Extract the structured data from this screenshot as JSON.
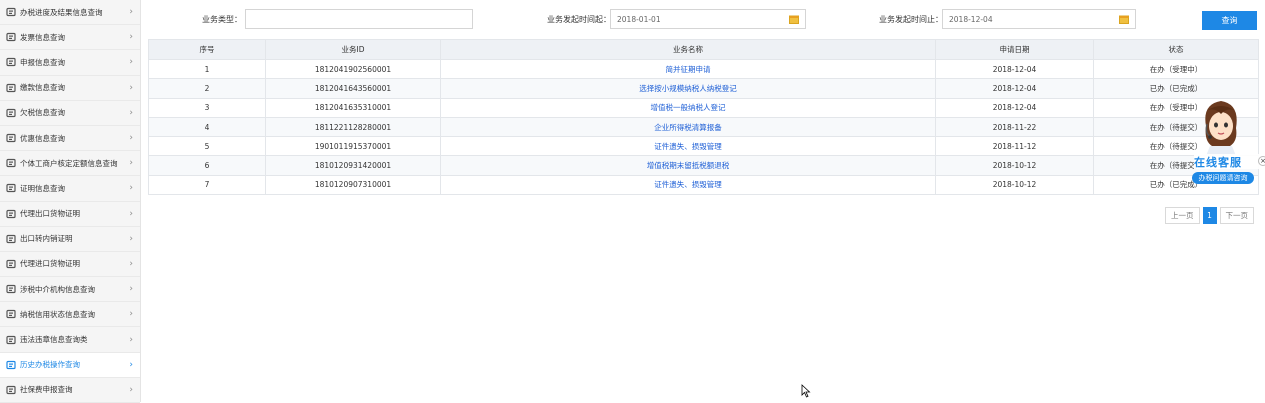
{
  "sidebar": {
    "items": [
      {
        "label": "办税进度及结果信息查询",
        "icon": "list-icon"
      },
      {
        "label": "发票信息查询",
        "icon": "invoice-icon"
      },
      {
        "label": "申报信息查询",
        "icon": "declare-icon"
      },
      {
        "label": "缴款信息查询",
        "icon": "payment-icon"
      },
      {
        "label": "欠税信息查询",
        "icon": "arrears-icon"
      },
      {
        "label": "优惠信息查询",
        "icon": "discount-icon"
      },
      {
        "label": "个体工商户核定定额信息查询",
        "icon": "quota-icon"
      },
      {
        "label": "证明信息查询",
        "icon": "certificate-icon"
      },
      {
        "label": "代理出口货物证明",
        "icon": "certificate-icon"
      },
      {
        "label": "出口转内销证明",
        "icon": "certificate-icon"
      },
      {
        "label": "代理进口货物证明",
        "icon": "certificate-icon"
      },
      {
        "label": "涉税中介机构信息查询",
        "icon": "agency-icon"
      },
      {
        "label": "纳税信用状态信息查询",
        "icon": "credit-icon"
      },
      {
        "label": "违法违章信息查询类",
        "icon": "violation-icon"
      },
      {
        "label": "历史办税操作查询",
        "icon": "history-icon",
        "active": true
      },
      {
        "label": "社保费申报查询",
        "icon": "user-icon"
      }
    ]
  },
  "filter": {
    "type_label": "业务类型：",
    "type_value": "",
    "start_label": "业务发起时间起：",
    "start_value": "2018-01-01",
    "end_label": "业务发起时间止：",
    "end_value": "2018-12-04",
    "query_label": "查询"
  },
  "table": {
    "headers": [
      "序号",
      "业务ID",
      "业务名称",
      "申请日期",
      "状态"
    ],
    "rows": [
      [
        "1",
        "1812041902560001",
        "简并征期申请",
        "2018-12-04",
        "在办（受理中）"
      ],
      [
        "2",
        "1812041643560001",
        "选择按小规模纳税人纳税登记",
        "2018-12-04",
        "已办（已完成）"
      ],
      [
        "3",
        "1812041635310001",
        "增值税一般纳税人登记",
        "2018-12-04",
        "在办（受理中）"
      ],
      [
        "4",
        "1811221128280001",
        "企业所得税清算报备",
        "2018-11-22",
        "在办（待提交）"
      ],
      [
        "5",
        "1901011915370001",
        "证件遗失、损毁管理",
        "2018-11-12",
        "在办（待提交）"
      ],
      [
        "6",
        "1810120931420001",
        "增值税期末留抵税额退税",
        "2018-10-12",
        "在办（待提交）"
      ],
      [
        "7",
        "1810120907310001",
        "证件遗失、损毁管理",
        "2018-10-12",
        "已办（已完成）"
      ]
    ]
  },
  "pager": {
    "prev": "上一页",
    "current": "1",
    "next": "下一页"
  },
  "service": {
    "title": "在线客服",
    "subtitle": "办税问题请咨询",
    "close": "×"
  },
  "colors": {
    "accent": "#1e88e5",
    "link": "#1e5fd6"
  }
}
